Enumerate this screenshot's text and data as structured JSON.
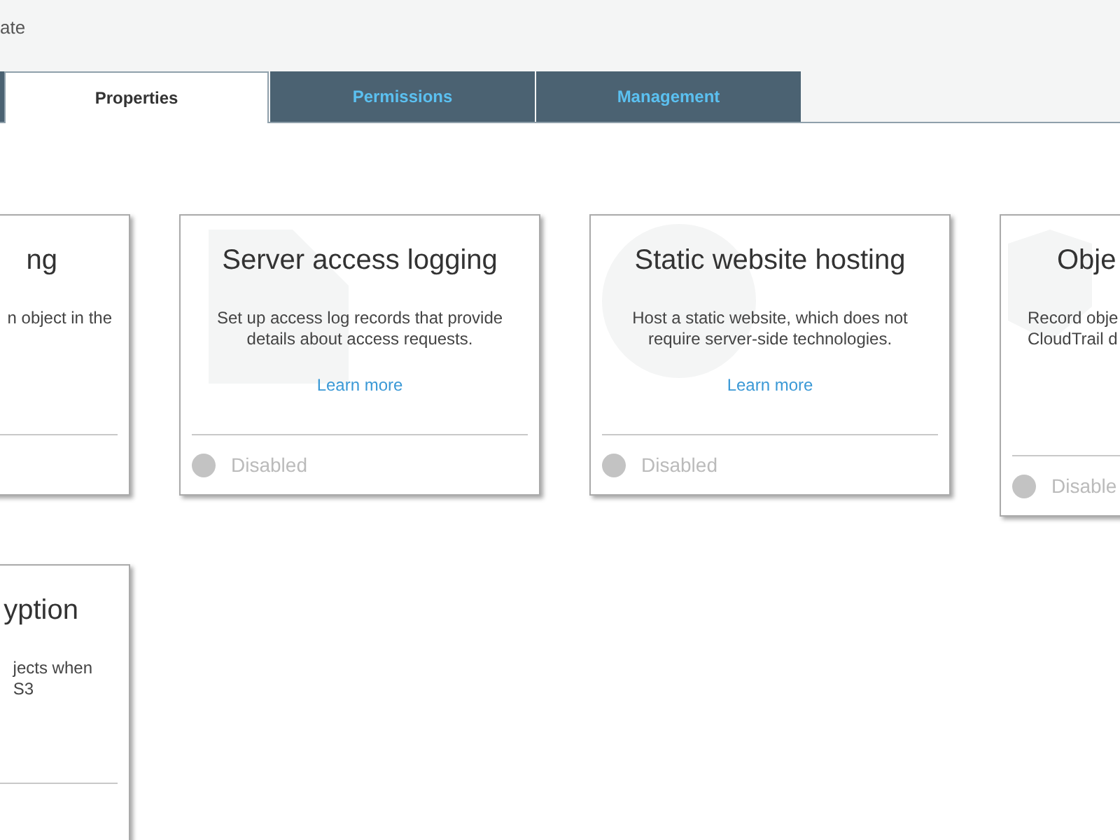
{
  "header": {
    "title": "ate"
  },
  "tabs": [
    {
      "label": "Properties",
      "selected": true
    },
    {
      "label": "Permissions",
      "selected": false
    },
    {
      "label": "Management",
      "selected": false
    }
  ],
  "card_rows": [
    [
      {
        "kind": "tail",
        "title": "ng",
        "description": [
          "n object in the"
        ]
      },
      {
        "kind": "full",
        "title": "Server access logging",
        "description": [
          "Set up access log records that provide",
          "details about access requests."
        ],
        "link": "Learn more",
        "status": "Disabled",
        "enabled": false
      },
      {
        "kind": "full",
        "title": "Static website hosting",
        "description": [
          "Host a static website, which does not",
          "require server-side technologies."
        ],
        "link": "Learn more",
        "status": "Disabled",
        "enabled": false
      },
      {
        "kind": "head",
        "title": "Obje",
        "description": [
          "Record obje",
          "CloudTrail d"
        ],
        "status": "Disable",
        "enabled": false
      }
    ],
    [
      {
        "kind": "tail",
        "title": "yption",
        "description": [
          "jects when",
          "S3"
        ]
      }
    ]
  ]
}
